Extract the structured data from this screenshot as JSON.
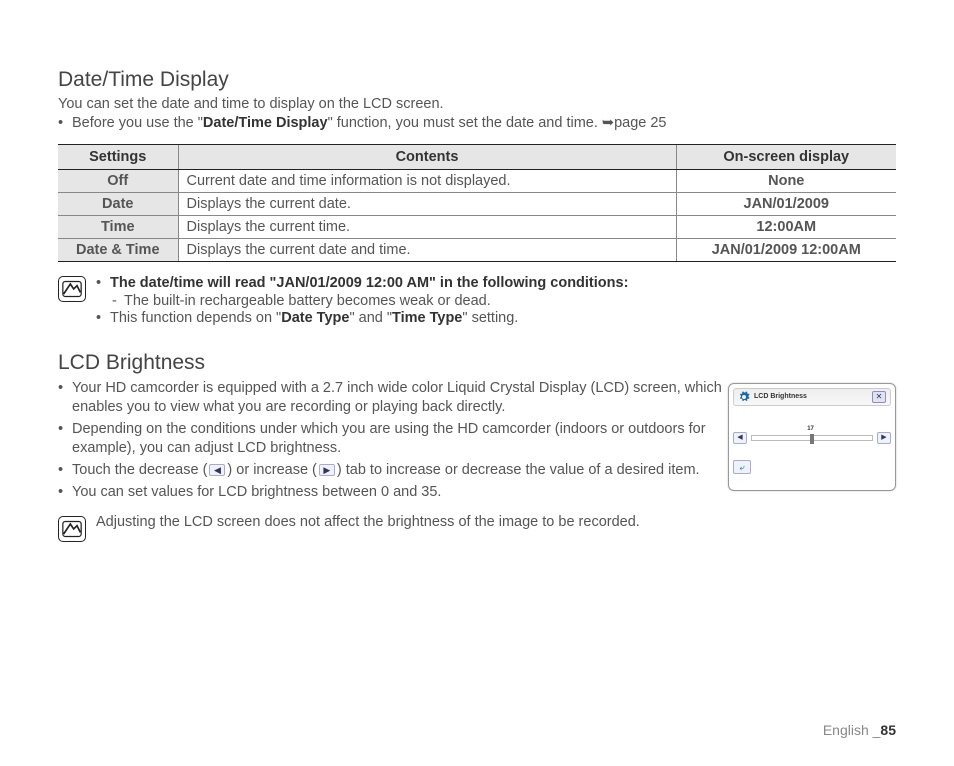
{
  "section1": {
    "title": "Date/Time Display",
    "intro": "You can set the date and time to display on the LCD screen.",
    "pre_note_before": "Before you use the \"",
    "pre_note_func": "Date/Time Display",
    "pre_note_after": "\" function, you must set the date and time. ",
    "page_ref": "page 25",
    "table": {
      "headers": [
        "Settings",
        "Contents",
        "On-screen display"
      ],
      "rows": [
        {
          "setting": "Off",
          "content": "Current date and time information is not displayed.",
          "display": "None"
        },
        {
          "setting": "Date",
          "content": "Displays the current date.",
          "display": "JAN/01/2009"
        },
        {
          "setting": "Time",
          "content": "Displays the current time.",
          "display": "12:00AM"
        },
        {
          "setting": "Date & Time",
          "content": "Displays the current date and time.",
          "display": "JAN/01/2009 12:00AM"
        }
      ]
    },
    "note": {
      "line1": "The date/time will read \"JAN/01/2009 12:00 AM\" in the following conditions:",
      "dash1": "The built-in rechargeable battery becomes weak or dead.",
      "line2_pre": "This function depends on \"",
      "line2_b1": "Date Type",
      "line2_mid": "\" and \"",
      "line2_b2": "Time Type",
      "line2_post": "\" setting."
    }
  },
  "section2": {
    "title": "LCD Brightness",
    "items": [
      "Your HD camcorder is equipped with a 2.7 inch wide color Liquid Crystal Display (LCD) screen, which enables you to view what you are recording or playing back directly.",
      "Depending on the conditions under which you are using the HD camcorder (indoors or outdoors for example), you can adjust LCD brightness.",
      "__ARROWS__",
      "You can set values for LCD brightness between 0 and 35."
    ],
    "item3_pre": "Touch the decrease (",
    "item3_mid": ") or increase (",
    "item3_post": ") tab to increase or decrease the value of a desired item.",
    "note": "Adjusting the LCD screen does not affect the brightness of the image to be recorded.",
    "mock": {
      "title": "LCD Brightness",
      "value": "17"
    }
  },
  "footer": {
    "lang": "English _",
    "page": "85"
  }
}
